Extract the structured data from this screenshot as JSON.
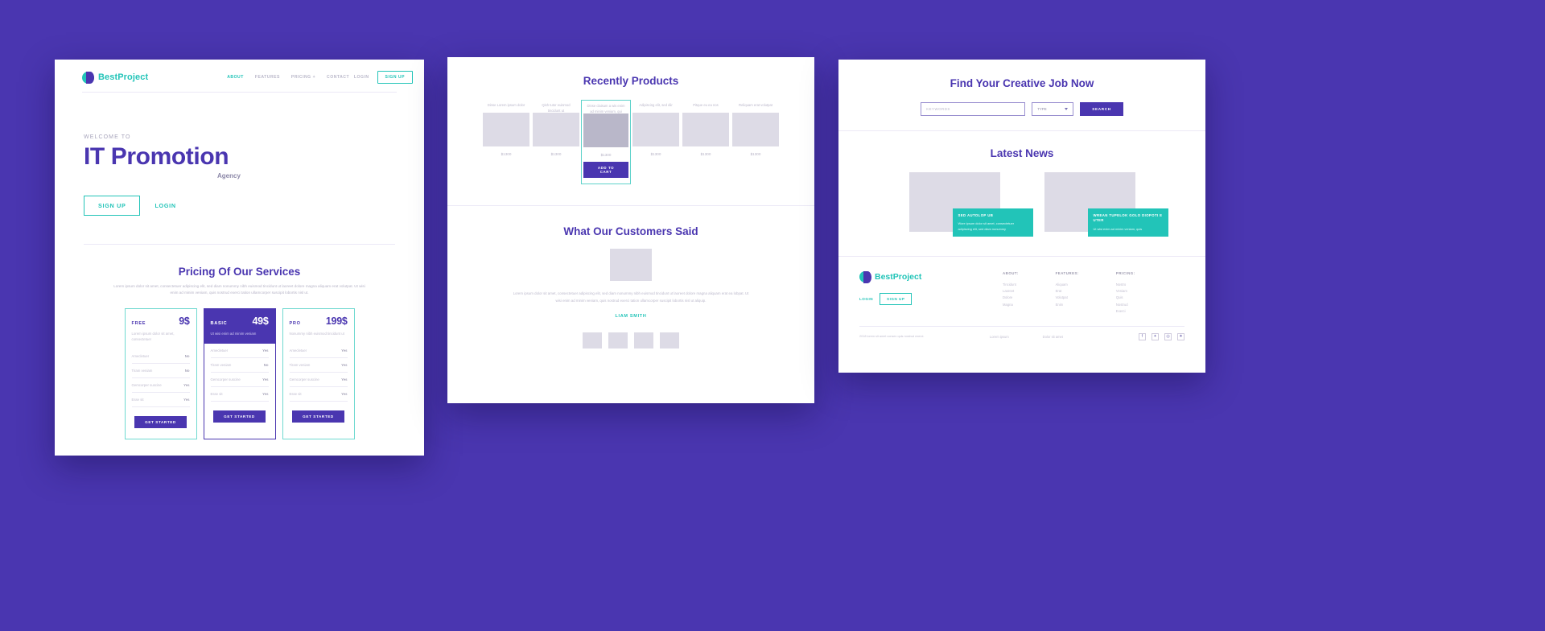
{
  "theme": {
    "purple": "#4a36b0",
    "teal": "#22c4b8",
    "grey": "#dddbe6",
    "page_bg": "#4a36b0"
  },
  "panel1": {
    "nav": {
      "logo": "BestProject",
      "links": [
        {
          "label": "ABOUT",
          "active": true
        },
        {
          "label": "FEATURES",
          "active": false
        },
        {
          "label": "PRICING +",
          "active": false
        },
        {
          "label": "CONTACT",
          "active": false
        }
      ],
      "login": "LOGIN",
      "signup": "SIGN UP"
    },
    "hero": {
      "eyebrow": "WELCOME TO",
      "title": "IT Promotion",
      "subtitle": "Agency",
      "primary_cta": "SIGN UP",
      "secondary_cta": "LOGIN"
    },
    "pricing": {
      "title": "Pricing Of Our Services",
      "lead": "Lorem ipsum dolor sit amet, consectetuer adipiscing elit, sed diam nonummy nibh euismod tincidunt ut laoreet dolore magna aliquam erat volutpat. Ut wisi enim ad minim veniam, quis nostrud exerci tation ullamcorper suscipit lobortis nisl ut.",
      "plans": [
        {
          "plan": "FREE",
          "price": "9$",
          "desc": "Lorem ipsum dolor sit amet, consectetuer",
          "featured": false,
          "rows": [
            {
              "label": "Amecletuer",
              "value": "No"
            },
            {
              "label": "Tiram veniam",
              "value": "No"
            },
            {
              "label": "Gemcorper suscine",
              "value": "Yes"
            },
            {
              "label": "Esse sit",
              "value": "Yes"
            }
          ],
          "cta": "GET STARTED"
        },
        {
          "plan": "BASIC",
          "price": "49$",
          "desc": "Ut wisi enim ad minim veniam",
          "featured": true,
          "rows": [
            {
              "label": "Amecletuer",
              "value": "Yes"
            },
            {
              "label": "Tiram veniam",
              "value": "No"
            },
            {
              "label": "Gemcorper suscine",
              "value": "Yes"
            },
            {
              "label": "Esse sit",
              "value": "Yes"
            }
          ],
          "cta": "GET STARTED"
        },
        {
          "plan": "PRO",
          "price": "199$",
          "desc": "Nonummy nibh euismod tincidunt ut",
          "featured": false,
          "rows": [
            {
              "label": "Amecletuer",
              "value": "Yes"
            },
            {
              "label": "Tiram veniam",
              "value": "Yes"
            },
            {
              "label": "Gemcorper suscine",
              "value": "Yes"
            },
            {
              "label": "Esse sit",
              "value": "Yes"
            }
          ],
          "cta": "GET STARTED"
        }
      ]
    }
  },
  "panel2": {
    "products": {
      "title": "Recently Products",
      "items": [
        {
          "name": "Dinse Lorem ipsum dolor",
          "price": "$1300",
          "active": false
        },
        {
          "name": "Qish tutor euismod tincidunt ut",
          "price": "$1300",
          "active": false
        },
        {
          "name": "Dinse claisum a wis enim ad minim veniam, qui",
          "price": "$1300",
          "active": true
        },
        {
          "name": "Adipiscing elit, sed diir",
          "price": "$1300",
          "active": false
        },
        {
          "name": "Pitque eu ea nos",
          "price": "$1300",
          "active": false
        },
        {
          "name": "Reliquam erat volutpat",
          "price": "$1300",
          "active": false
        }
      ],
      "cart_cta": "ADD TO CART"
    },
    "testimonials": {
      "title": "What Our Customers Said",
      "quote": "Lorem ipsum dolor sit amet, consectetuer adipiscing elit, sed diam nonummy nibh euismod tincidunt ut laoreet dolore magna aliquam erat ea lobpat. Ut wisi enim ad minim veniam, quis nostrud exerci tation ullamcorper suscipit lobortis nisl ut aliquip.",
      "author": "LIAM SMITH"
    }
  },
  "panel3": {
    "jobs": {
      "title": "Find Your Creative Job Now",
      "keywords_placeholder": "KEYWORDS",
      "keywords_value": "",
      "type_label": "TYPE",
      "search_cta": "SEARCH"
    },
    "news": {
      "title": "Latest News",
      "items": [
        {
          "cap_title": "SED AUTOLOP UB",
          "cap_text": "Wore ipsum dolor sit amet, consectetuer adipiscing elit, sed diam nonummy"
        },
        {
          "cap_title": "WREAN TUPELOK GOLO DIOPOTI E UTER",
          "cap_text": "Ut wisi enim ad minim veniam, quis"
        }
      ]
    },
    "footer": {
      "logo": "BestProject",
      "login": "LOGIN",
      "signup": "SIGN UP",
      "columns": [
        {
          "title": "ABOUT:",
          "items": [
            "Tincidunt",
            "Laoreet",
            "Dolore",
            "Magna"
          ]
        },
        {
          "title": "FEATURES:",
          "items": [
            "Aliquam",
            "Erat",
            "Volutpat",
            "Enim"
          ]
        },
        {
          "title": "PRICING:",
          "items": [
            "Nostro",
            "Veniam",
            "Quis",
            "Nostrud",
            "Exerci"
          ]
        }
      ],
      "copyright": "2018 lorem sit amet consec quis nostrud exerci.",
      "mid_links": [
        "Lorem ipsum",
        "Dolor sit amet"
      ],
      "social": [
        "facebook-icon",
        "twitter-icon",
        "instagram-icon",
        "star-icon"
      ],
      "social_glyphs": [
        "f",
        "✦",
        "◎",
        "✷"
      ]
    }
  }
}
